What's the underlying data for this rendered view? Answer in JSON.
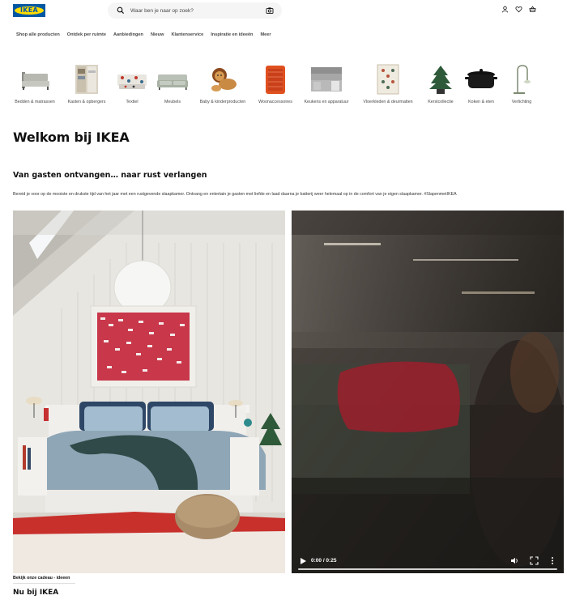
{
  "header": {
    "logo_text": "IKEA",
    "search": {
      "placeholder": "Waar ben je naar op zoek?"
    },
    "icons": [
      "search-icon",
      "camera-icon",
      "account-icon",
      "heart-icon",
      "basket-icon"
    ]
  },
  "nav": {
    "items": [
      "Shop alle producten",
      "Ontdek per ruimte",
      "Aanbiedingen",
      "Nieuw",
      "Klantenservice",
      "Inspiratie en ideeën",
      "Meer"
    ]
  },
  "categories": [
    {
      "label": "Bedden & matrassen"
    },
    {
      "label": "Kasten & opbergers"
    },
    {
      "label": "Textiel"
    },
    {
      "label": "Meubels"
    },
    {
      "label": "Baby & kinderproducten"
    },
    {
      "label": "Woonaccessoires"
    },
    {
      "label": "Keukens en apparatuur"
    },
    {
      "label": "Vloerkleden & deurmatten"
    },
    {
      "label": "Kerstcollectie"
    },
    {
      "label": "Koken & eten"
    },
    {
      "label": "Verlichting"
    }
  ],
  "main": {
    "welcome": "Welkom bij IKEA",
    "subheading": "Van gasten ontvangen… naar rust verlangen",
    "paragraph": "Bereid je voor op de mooiste en drukste tijd van het jaar met een rustgevende slaapkamer. Ontvang en entertain je gasten met liefde en laad daarna je batterij weer helemaal op in de comfort van je eigen slaapkamer. #SlapenmetIKEA",
    "video": {
      "time": "0:00 / 0:25",
      "progress": 0
    },
    "caption": "Bekijk onze cadeau - ideeen",
    "nu_heading": "Nu bij IKEA"
  },
  "colors": {
    "brand_blue": "#0058a3",
    "brand_yellow": "#ffdb00",
    "text": "#111111"
  }
}
